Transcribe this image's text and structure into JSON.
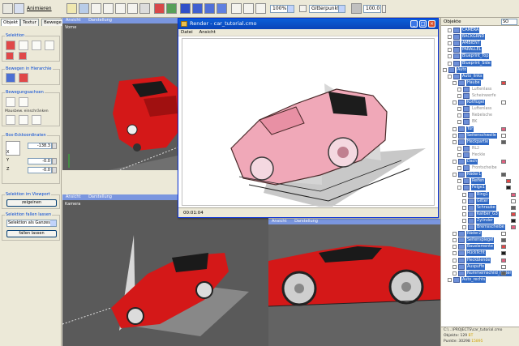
{
  "toolbar": {
    "menu_label": "Animieren",
    "zoom_value": "100%",
    "snap_mode": "Gitterpunkte",
    "grid_value": "100.0"
  },
  "left_panel": {
    "tabs": [
      "Objekt",
      "Textur",
      "Bewege"
    ],
    "groups": {
      "selection_title": "Selektion",
      "move_hierarchy_title": "Bewegen in Hierarchie",
      "move_axes_title": "Bewegungsachsen",
      "move_axes_note": "Mausbew. einschränken",
      "box_corner_title": "Box-Eckkoordinaten",
      "viewport_select_title": "Selektion im Viewport",
      "drop_selection_title": "Selektion fallen lassen"
    },
    "coords": [
      {
        "axis": "X",
        "value": "-138.3"
      },
      {
        "axis": "Y",
        "value": "-0.0"
      },
      {
        "axis": "Z",
        "value": "-0.0"
      }
    ],
    "buttons": {
      "show": "zeigeinen",
      "selection_whole": "Selektion als Ganzes",
      "drop": "fallen lassen"
    }
  },
  "viewports": {
    "top_left": {
      "tabs": [
        "Ansicht",
        "Darstellung"
      ],
      "label": "Vorne"
    },
    "bottom_left": {
      "tabs": [
        "Ansicht",
        "Darstellung"
      ],
      "label": "Kamera"
    },
    "bottom_right": {
      "tabs": [
        "Ansicht",
        "Darstellung"
      ],
      "label": ""
    }
  },
  "render_window": {
    "title": "Render - car_tutorial.cmo",
    "menu": [
      "Datei",
      "Ansicht"
    ],
    "status_time": "00:01:04",
    "min_glyph": "_",
    "max_glyph": "□",
    "close_glyph": "×"
  },
  "right_panel": {
    "header": "Objekte",
    "selector": "SO",
    "tree": [
      {
        "label": "CAMERA",
        "indent": 1,
        "selected": true
      },
      {
        "label": "BACKGRND",
        "indent": 1,
        "selected": true
      },
      {
        "label": "AMBIENT",
        "indent": 1,
        "selected": true
      },
      {
        "label": "PARALLEL",
        "indent": 1,
        "selected": true
      },
      {
        "label": "Blueprint_Top",
        "indent": 1,
        "selected": true
      },
      {
        "label": "Blueprint_Side",
        "indent": 1,
        "selected": true
      },
      {
        "label": "Auto",
        "indent": 0,
        "selected": true
      },
      {
        "label": "Auto_links",
        "indent": 1,
        "selected": true
      },
      {
        "label": "Haube",
        "indent": 2,
        "selected": true
      },
      {
        "label": "Luftenlass",
        "indent": 3,
        "selected": false
      },
      {
        "label": "Scheinwerfe",
        "indent": 3,
        "selected": false
      },
      {
        "label": "Kotflügel",
        "indent": 2,
        "selected": true
      },
      {
        "label": "Luftenlass",
        "indent": 3,
        "selected": false
      },
      {
        "label": "Nebelsche",
        "indent": 3,
        "selected": false
      },
      {
        "label": "BK",
        "indent": 3,
        "selected": false
      },
      {
        "label": "Tür",
        "indent": 2,
        "selected": true
      },
      {
        "label": "Seitenschwelle",
        "indent": 2,
        "selected": true
      },
      {
        "label": "Heckpartie",
        "indent": 2,
        "selected": true
      },
      {
        "label": "RL2",
        "indent": 3,
        "selected": false
      },
      {
        "label": "Heckle",
        "indent": 3,
        "selected": false
      },
      {
        "label": "Dach",
        "indent": 2,
        "selected": true
      },
      {
        "label": "Frontscheibe",
        "indent": 3,
        "selected": false
      },
      {
        "label": "Räder1",
        "indent": 2,
        "selected": true
      },
      {
        "label": "Reifen",
        "indent": 3,
        "selected": true
      },
      {
        "label": "Felge1",
        "indent": 3,
        "selected": true
      },
      {
        "label": "Ring1",
        "indent": 4,
        "selected": true
      },
      {
        "label": "Gitter",
        "indent": 4,
        "selected": true
      },
      {
        "label": "Schraube",
        "indent": 4,
        "selected": true
      },
      {
        "label": "Kaliber_G3",
        "indent": 4,
        "selected": true
      },
      {
        "label": "Zylinder",
        "indent": 4,
        "selected": true
      },
      {
        "label": "Bremsscheibe",
        "indent": 4,
        "selected": true
      },
      {
        "label": "Räder2",
        "indent": 2,
        "selected": true
      },
      {
        "label": "Seitenspiegel",
        "indent": 2,
        "selected": true
      },
      {
        "label": "Bauelemente",
        "indent": 2,
        "selected": true
      },
      {
        "label": "Rücklicht",
        "indent": 2,
        "selected": true
      },
      {
        "label": "Heckblende",
        "indent": 2,
        "selected": true
      },
      {
        "label": "Auspuffe",
        "indent": 2,
        "selected": true
      },
      {
        "label": "Nummernschild_hinter",
        "indent": 2,
        "selected": true
      },
      {
        "label": "Auto_rechts",
        "indent": 1,
        "selected": true
      }
    ],
    "info": {
      "path": "C:\\...\\PROJECTS\\car_tutorial.cmo",
      "objects_label": "Objekte: 129",
      "objects_extra": "BT",
      "points_label": "Punkte: 30298",
      "points_extra": "15895"
    }
  },
  "colors": {
    "selection_blue": "#316ac5",
    "car_red": "#d41818",
    "viewport_bg": "#5a5a5a"
  }
}
